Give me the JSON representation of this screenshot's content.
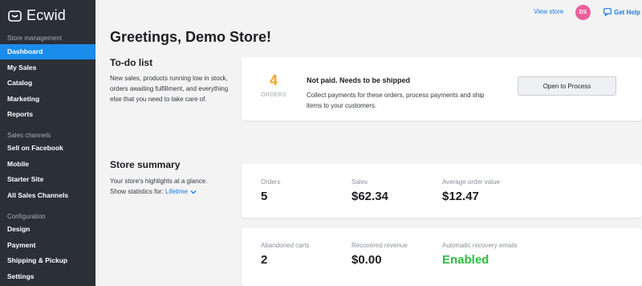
{
  "app": {
    "name": "Ecwid"
  },
  "sidebar": {
    "sections": [
      {
        "label": "Store management"
      },
      {
        "label": "Sales channels"
      },
      {
        "label": "Configuration"
      }
    ],
    "items": [
      {
        "label": "Dashboard",
        "active": true
      },
      {
        "label": "My Sales"
      },
      {
        "label": "Catalog"
      },
      {
        "label": "Marketing"
      },
      {
        "label": "Reports"
      },
      {
        "label": "Sell on Facebook"
      },
      {
        "label": "Mobile"
      },
      {
        "label": "Starter Site"
      },
      {
        "label": "All Sales Channels"
      },
      {
        "label": "Design"
      },
      {
        "label": "Payment"
      },
      {
        "label": "Shipping & Pickup"
      },
      {
        "label": "Settings"
      }
    ]
  },
  "topbar": {
    "view_store": "View store",
    "avatar_initials": "DS",
    "help": "Get Help"
  },
  "page": {
    "title": "Greetings, Demo Store!"
  },
  "todo": {
    "title": "To-do list",
    "desc": "New sales, products running low in stock, orders awaiting fulfillment, and everything else that you need to take care of.",
    "count": "4",
    "count_label": "ORDERS",
    "item_title": "Not paid. Needs to be shipped",
    "item_desc": "Collect payments for these orders, process payments and ship items to your customers.",
    "button": "Open to Process"
  },
  "summary": {
    "title": "Store summary",
    "desc": "Your store's highlights at a glance.",
    "stats_prefix": "Show statistics for:",
    "period": "Lifetime",
    "row1": [
      {
        "label": "Orders",
        "value": "5"
      },
      {
        "label": "Sales",
        "value": "$62.34"
      },
      {
        "label": "Average order value",
        "value": "$12.47"
      }
    ],
    "row2": [
      {
        "label": "Abandoned carts",
        "value": "2"
      },
      {
        "label": "Recovered revenue",
        "value": "$0.00"
      },
      {
        "label": "Automatic recovery emails",
        "value": "Enabled"
      }
    ]
  },
  "colors": {
    "sidebar_bg": "#2b2f36",
    "accent": "#1a8cec",
    "orange": "#f5a623",
    "green": "#2bbf3d",
    "avatar": "#e8609c"
  }
}
